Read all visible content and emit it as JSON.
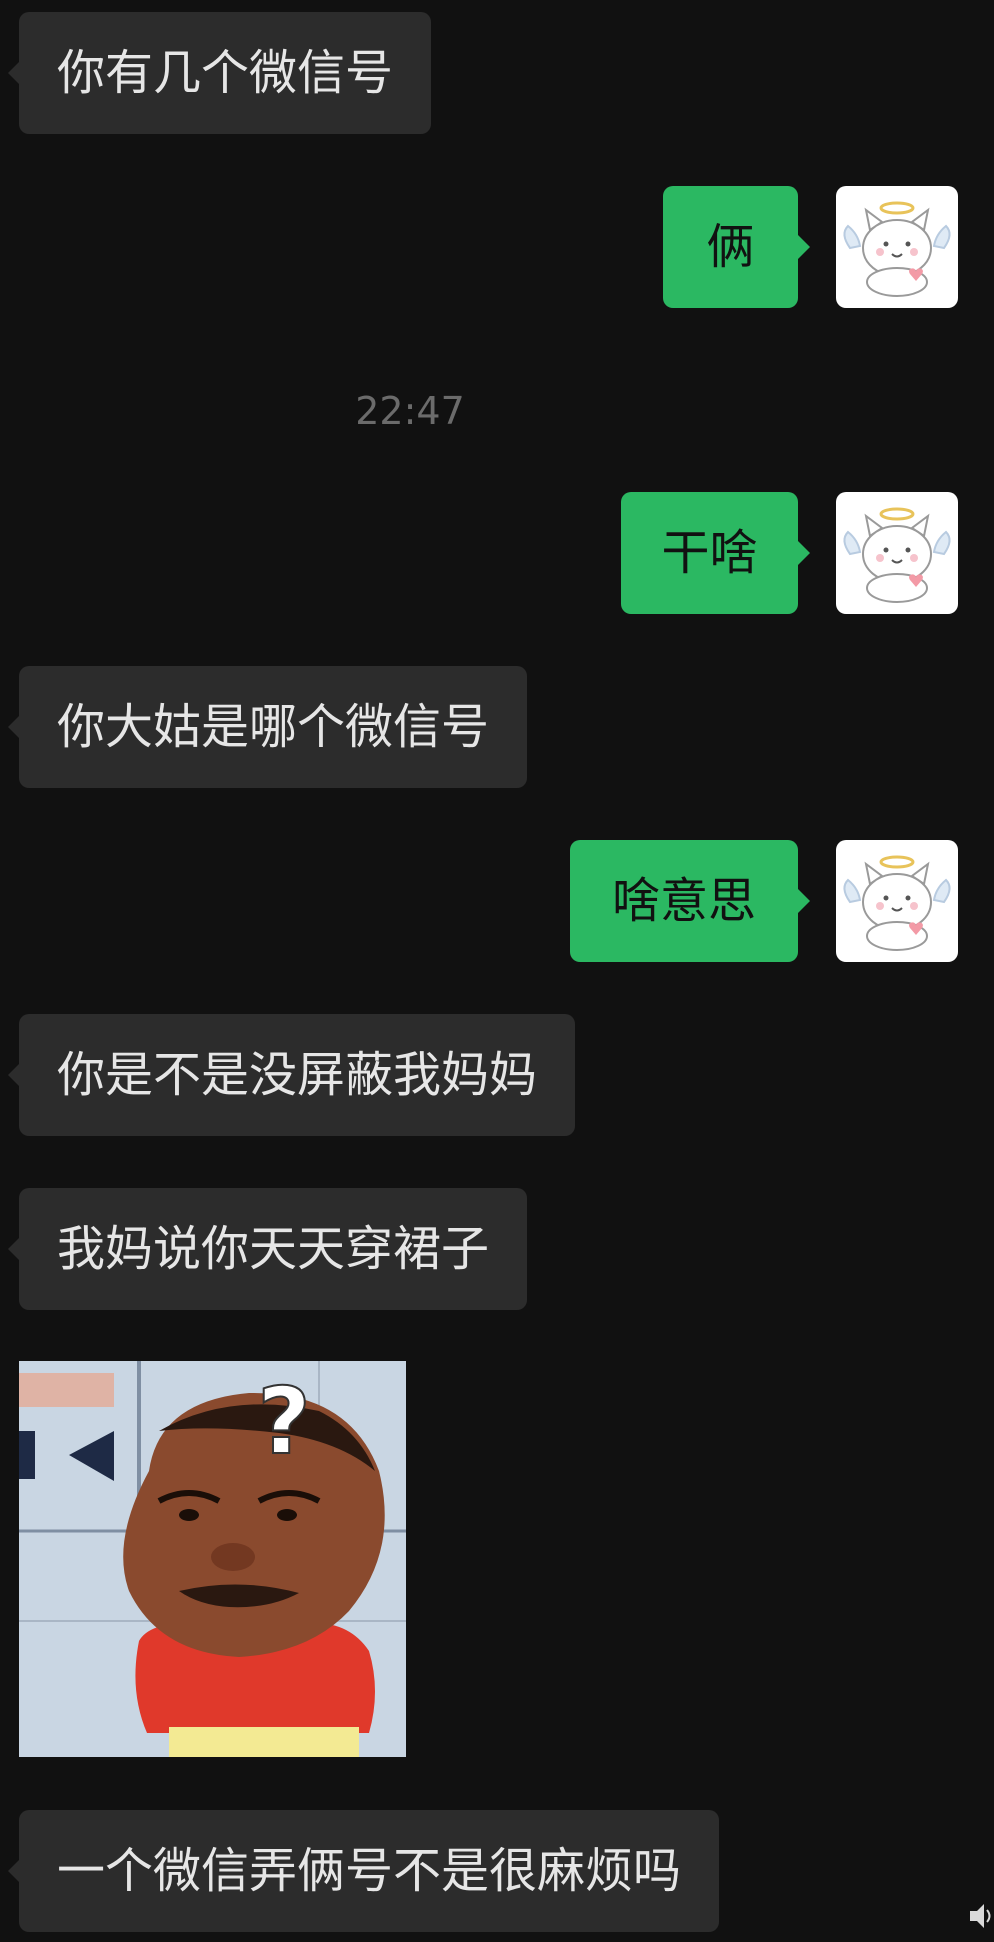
{
  "chat": {
    "messages": [
      {
        "side": "left",
        "type": "text",
        "text": "你有几个微信号"
      },
      {
        "side": "right",
        "type": "text",
        "text": "俩"
      },
      {
        "type": "time",
        "text": "22:47"
      },
      {
        "side": "right",
        "type": "text",
        "text": "干啥"
      },
      {
        "side": "left",
        "type": "text",
        "text": "你大姑是哪个微信号"
      },
      {
        "side": "right",
        "type": "text",
        "text": "啥意思"
      },
      {
        "side": "left",
        "type": "text",
        "text": "你是不是没屏蔽我妈妈"
      },
      {
        "side": "left",
        "type": "text",
        "text": "我妈说你天天穿裙子"
      },
      {
        "side": "left",
        "type": "sticker",
        "sticker_icon": "confused-man-question-mark-sticker",
        "sticker_text": "?"
      },
      {
        "side": "left",
        "type": "text",
        "text": "一个微信弄俩号不是很麻烦吗"
      }
    ]
  },
  "colors": {
    "background": "#111111",
    "incoming_bubble": "#2c2c2c",
    "outgoing_bubble": "#2bb862",
    "timestamp_text": "#6b6b6b"
  },
  "icons": {
    "self_avatar": "angel-cat-avatar-icon",
    "edge": "speaker-icon"
  }
}
